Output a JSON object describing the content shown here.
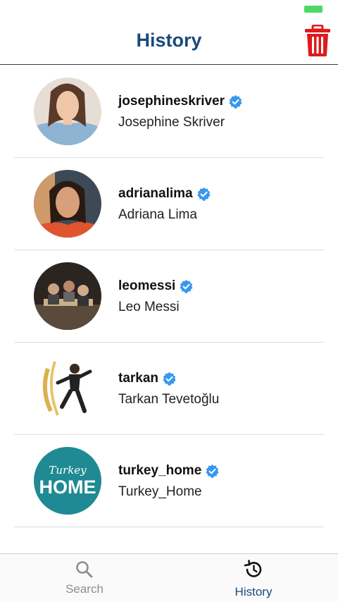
{
  "header": {
    "title": "History",
    "trash_icon": "trash-icon",
    "trash_color": "#e0191b"
  },
  "history": [
    {
      "username": "josephineskriver",
      "full_name": "Josephine Skriver",
      "verified": true
    },
    {
      "username": "adrianalima",
      "full_name": "Adriana Lima",
      "verified": true
    },
    {
      "username": "leomessi",
      "full_name": "Leo Messi",
      "verified": true
    },
    {
      "username": "tarkan",
      "full_name": "Tarkan Tevetoğlu",
      "verified": true
    },
    {
      "username": "turkey_home",
      "full_name": "Turkey_Home",
      "verified": true,
      "avatar_text_top": "Turkey",
      "avatar_text_main": "HOME"
    }
  ],
  "tabs": [
    {
      "label": "Search",
      "icon": "search-icon",
      "active": false
    },
    {
      "label": "History",
      "icon": "history-icon",
      "active": true
    }
  ],
  "colors": {
    "accent": "#1a4a7a",
    "verified": "#3897f0",
    "battery": "#4cd964"
  }
}
